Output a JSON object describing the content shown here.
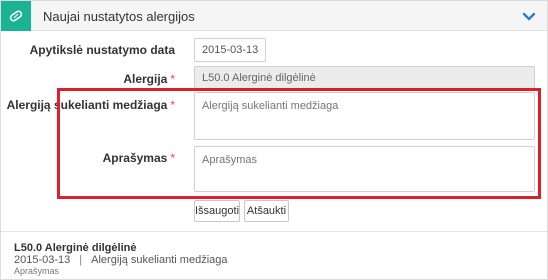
{
  "header": {
    "title": "Naujai nustatytos alergijos",
    "icon": "bandage-icon",
    "collapse_icon": "chevron-down-icon",
    "accent_color": "#1ab394"
  },
  "form": {
    "date_label": "Apytikslė nustatymo data",
    "date_value": "2015-03-13",
    "allergy_label": "Alergija",
    "allergy_value": "L50.0 Alerginė dilgėlinė",
    "allergen_label": "Alergiją sukelianti medžiaga",
    "allergen_placeholder": "Alergiją sukelianti medžiaga",
    "description_label": "Aprašymas",
    "description_placeholder": "Aprašymas",
    "required_mark": "*",
    "highlight_color": "#dd1f2c"
  },
  "actions": {
    "save_label": "Išsaugoti",
    "cancel_label": "Atšaukti"
  },
  "entry": {
    "title": "L50.0 Alerginė dilgėlinė",
    "date": "2015-03-13",
    "separator": "|",
    "allergen": "Alergiją sukelianti medžiaga",
    "description": "Aprašymas"
  }
}
